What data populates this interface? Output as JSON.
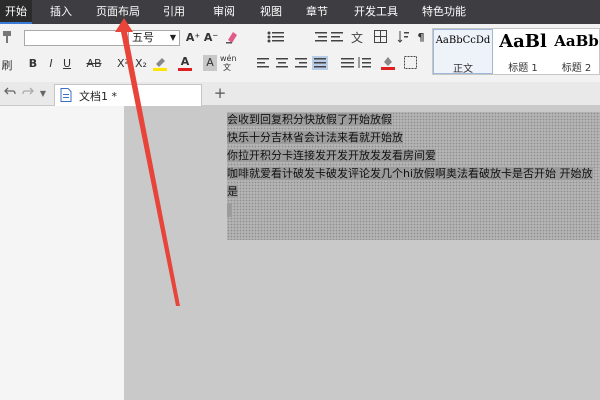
{
  "menu": {
    "items": [
      {
        "label": "开始",
        "active": true
      },
      {
        "label": "插入"
      },
      {
        "label": "页面布局"
      },
      {
        "label": "引用"
      },
      {
        "label": "审阅"
      },
      {
        "label": "视图"
      },
      {
        "label": "章节"
      },
      {
        "label": "开发工具"
      },
      {
        "label": "特色功能"
      }
    ]
  },
  "ribbon": {
    "format_painter_label": "刷",
    "font_size_value": "五号",
    "grow_label": "A⁺",
    "shrink_label": "A⁻",
    "bold": "B",
    "italic": "I",
    "underline": "U",
    "strike": "AB",
    "superscript": "X²",
    "subscript": "X₂",
    "font_color": "A",
    "char_shade": "A",
    "styles": [
      {
        "sample": "AaBbCcDd",
        "name": "正文"
      },
      {
        "sample": "AaBl",
        "name": "标题 1"
      },
      {
        "sample": "AaBb",
        "name": "标题 2"
      }
    ]
  },
  "tabs": {
    "doc_title": "文档1 *",
    "new_tab": "+"
  },
  "document": {
    "lines": [
      "会收到回复积分快放假了开始放假",
      "快乐十分吉林省会计法来看就开始放",
      "你拉开积分卡连接发开发开放发发看房间爱",
      "咖啡就爱看计破发卡破发评论发几个hi放假啊奥法看破放卡是否开始 开始放",
      "是"
    ]
  },
  "colors": {
    "menubar": "#3e3e42",
    "arrow": "#e8443a",
    "selection": "#b4b4b4"
  }
}
